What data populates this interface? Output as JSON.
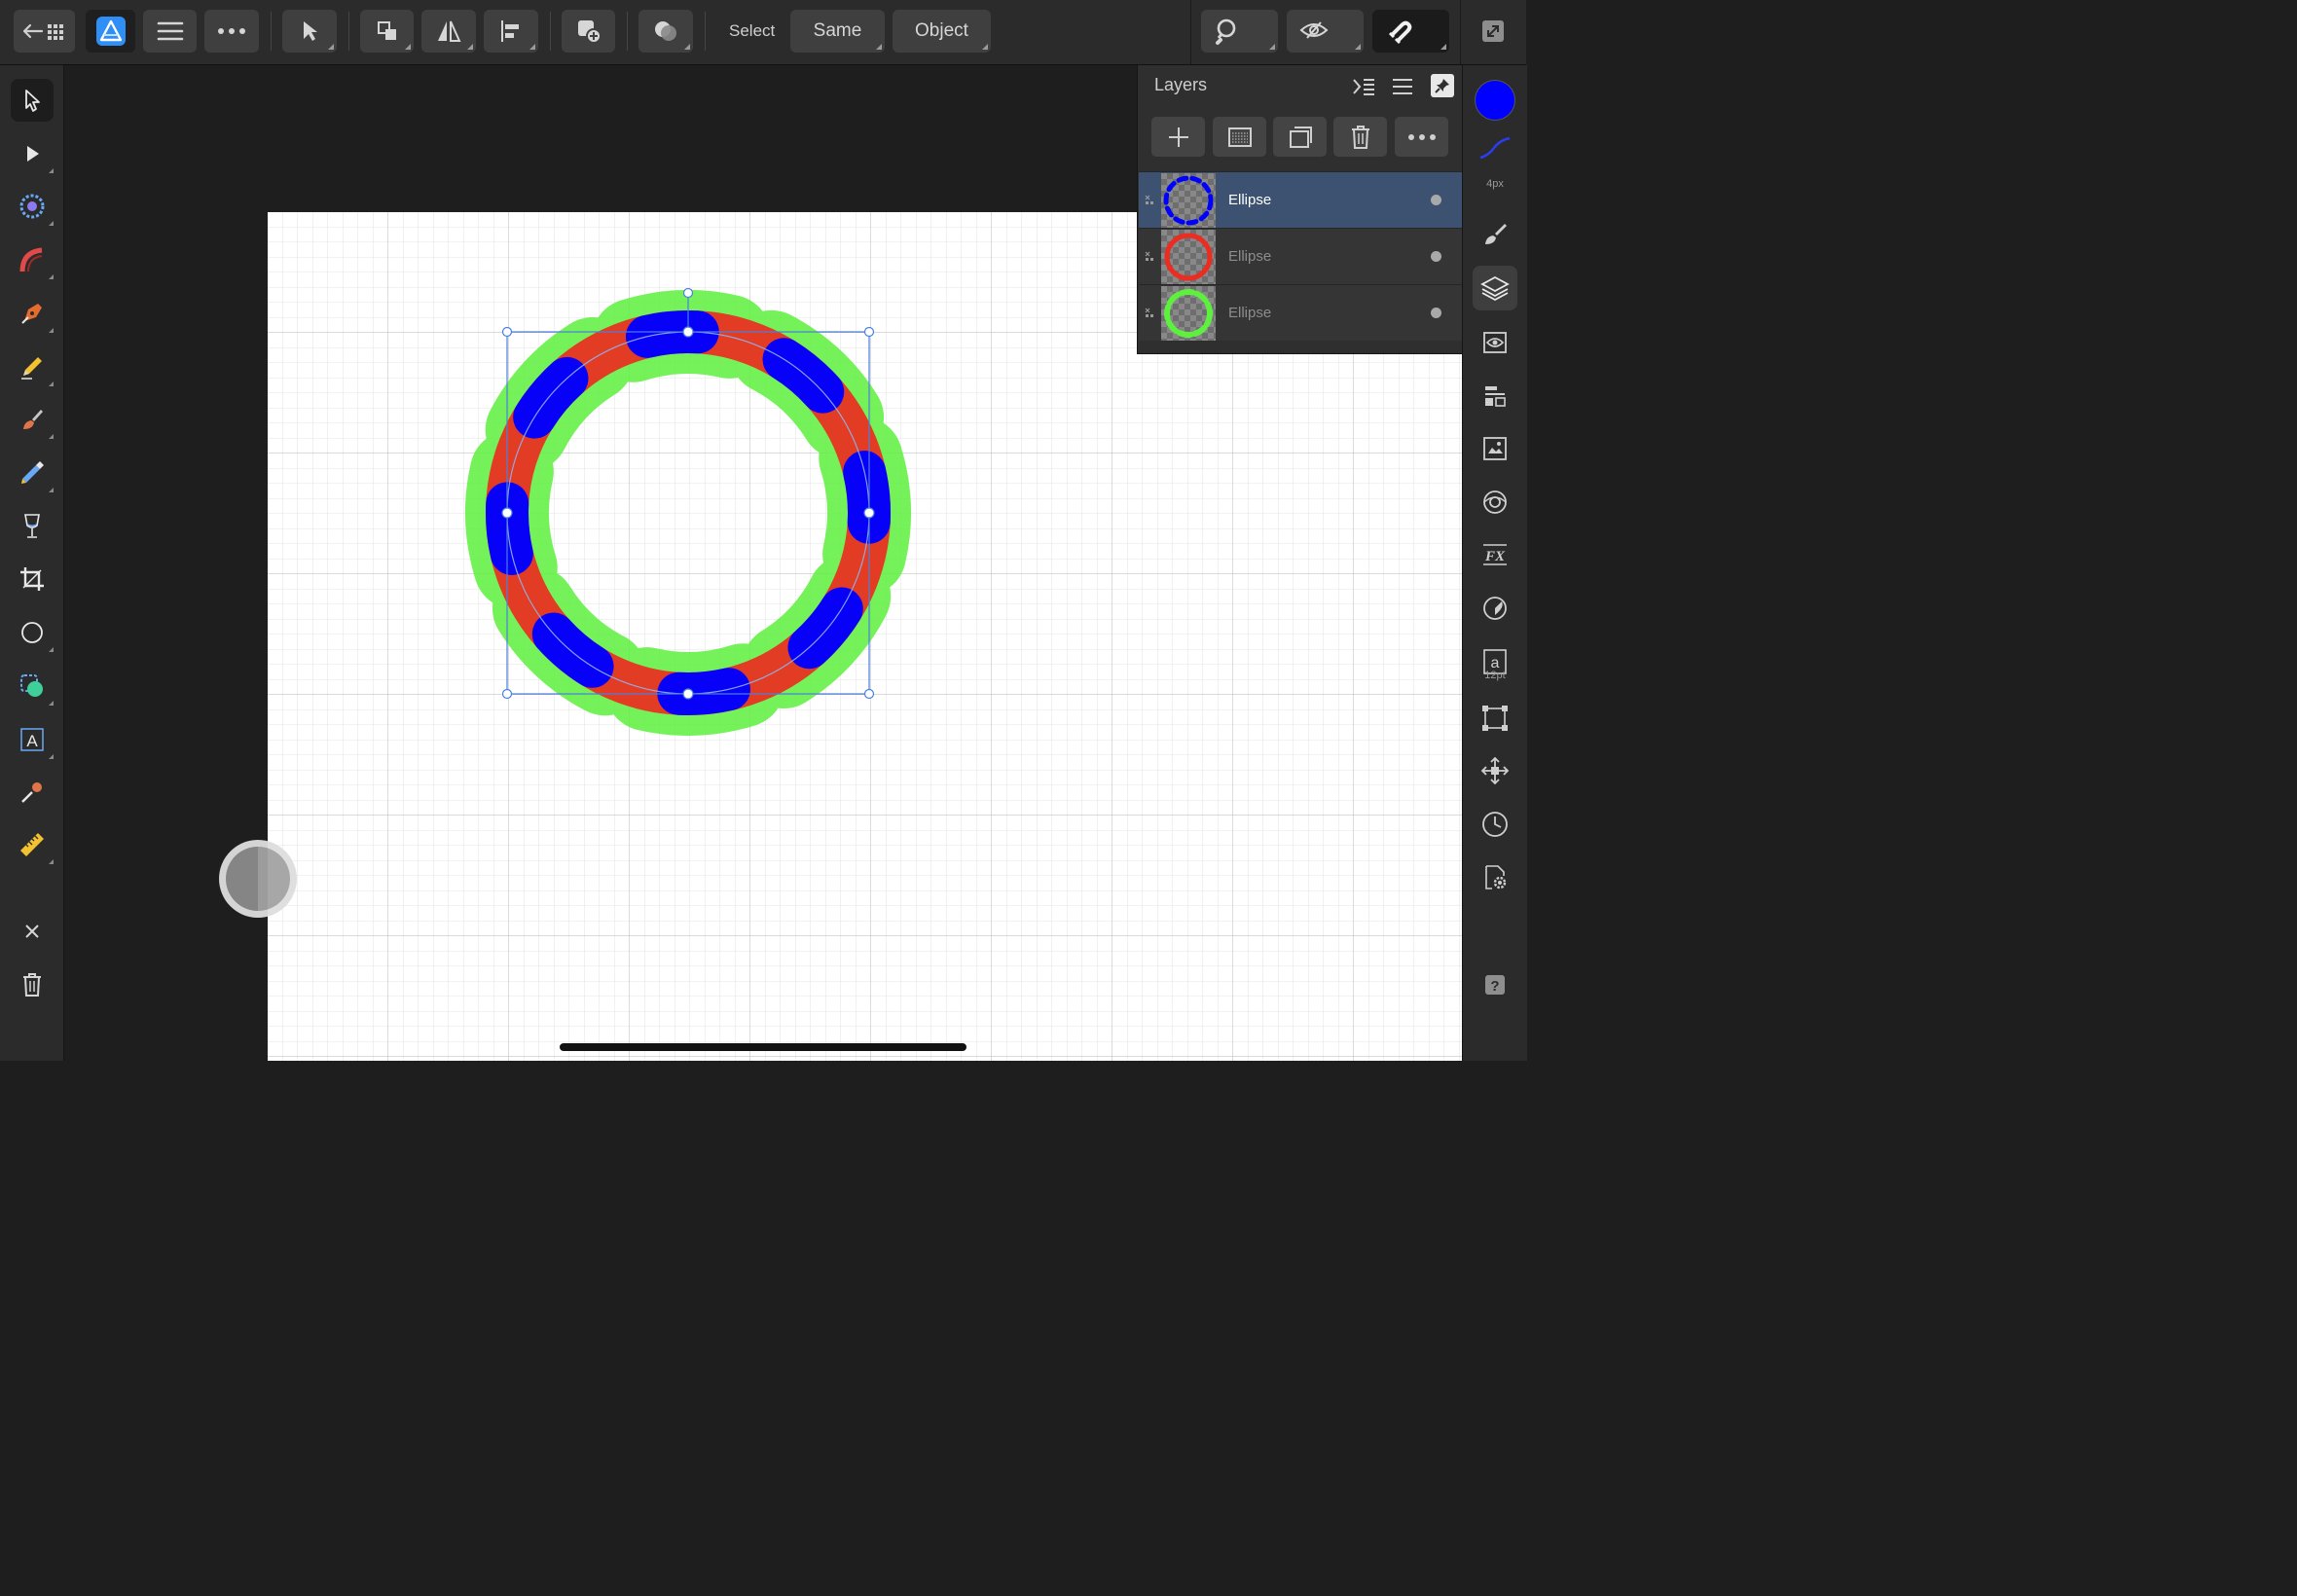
{
  "topbar": {
    "select_label": "Select",
    "same_label": "Same",
    "object_label": "Object"
  },
  "colors": {
    "fill": "#0000ff",
    "stroke_outer": "#5ef03e",
    "stroke_middle": "#ec2c20",
    "selection": "#4a7fe0",
    "accent_app": "#2f8ff5"
  },
  "rightbar": {
    "brush_size": "4px",
    "font_size": "12pt"
  },
  "layers_panel": {
    "title": "Layers",
    "rows": [
      {
        "name": "Ellipse",
        "selected": true,
        "thumb": "blue-dashed-ring"
      },
      {
        "name": "Ellipse",
        "selected": false,
        "thumb": "red-ring"
      },
      {
        "name": "Ellipse",
        "selected": false,
        "thumb": "green-wavy-ring"
      }
    ]
  },
  "icons": {
    "left_tools": [
      "move-tool-icon",
      "node-tool-icon",
      "flood-select-icon",
      "brush-selection-icon",
      "pen-tool-icon",
      "pencil-tool-icon",
      "paint-brush-icon",
      "pixel-tool-icon",
      "fill-tool-icon",
      "crop-tool-icon",
      "ellipse-tool-icon",
      "shape-builder-icon",
      "artistic-text-icon",
      "color-picker-icon",
      "measure-tool-icon",
      "close-icon",
      "trash-icon"
    ],
    "right_studio": [
      "color-swatch-icon",
      "stroke-icon",
      "brushes-icon",
      "layers-icon",
      "appearance-icon",
      "stroke-panel-icon",
      "text-styles-icon",
      "navigator-icon",
      "effects-icon",
      "styles-icon",
      "character-icon",
      "transform-icon",
      "snapping-icon",
      "history-icon",
      "settings-icon",
      "help-icon"
    ]
  }
}
